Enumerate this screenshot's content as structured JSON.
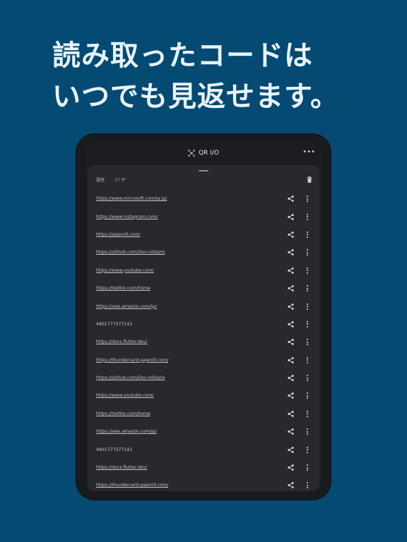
{
  "headline": {
    "line1": "読み取ったコードは",
    "line2": "いつでも見返せます。"
  },
  "app": {
    "title": "QR I/O",
    "more_label": "•••"
  },
  "sheet": {
    "history_label": "履歴",
    "count_label": "17 件"
  },
  "items": [
    {
      "text": "https://www.microsoft.com/ja-jp/",
      "link": true
    },
    {
      "text": "https://www.instagram.com/",
      "link": true
    },
    {
      "text": "https://gajeroll.com/",
      "link": true
    },
    {
      "text": "https://github.com/Dev-roll/qrio",
      "link": true
    },
    {
      "text": "https://www.youtube.com/",
      "link": true
    },
    {
      "text": "https://twitter.com/home",
      "link": true
    },
    {
      "text": "https://aws.amazon.com/jp/",
      "link": true
    },
    {
      "text": "4901777377141",
      "link": false
    },
    {
      "text": "https://docs.flutter.dev/",
      "link": true
    },
    {
      "text": "https://thundercard.gajeroll.com/",
      "link": true
    },
    {
      "text": "https://github.com/Dev-roll/qrio",
      "link": true
    },
    {
      "text": "https://www.youtube.com/",
      "link": true
    },
    {
      "text": "https://twitter.com/home",
      "link": true
    },
    {
      "text": "https://aws.amazon.com/jp/",
      "link": true
    },
    {
      "text": "4901777377141",
      "link": false
    },
    {
      "text": "https://docs.flutter.dev/",
      "link": true
    },
    {
      "text": "https://thundercard.gajeroll.com/",
      "link": true
    }
  ],
  "icons": {
    "app_logo": "qr-scan-icon",
    "more": "more-horizontal-icon",
    "trash": "trash-icon",
    "share": "share-icon",
    "menu": "more-vertical-icon"
  }
}
